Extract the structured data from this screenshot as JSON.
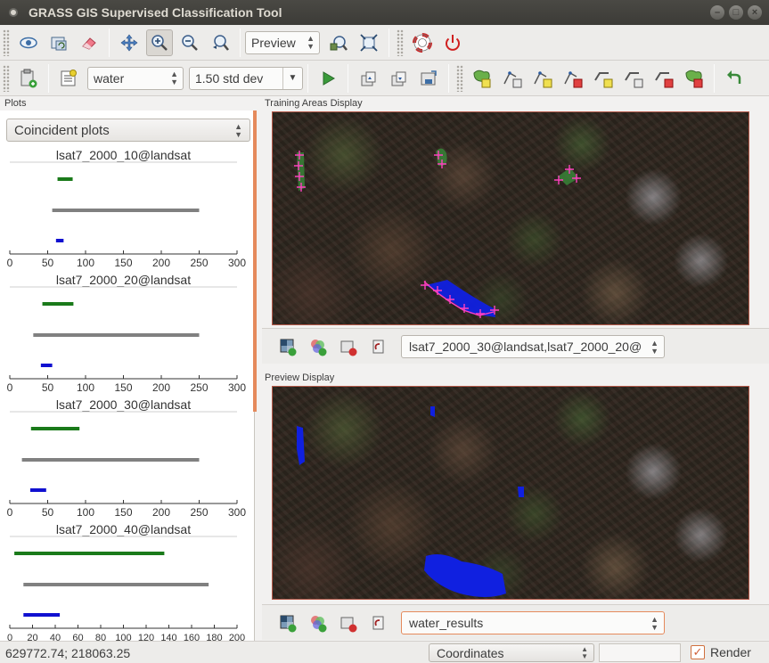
{
  "window": {
    "title": "GRASS GIS Supervised Classification Tool",
    "buttons": [
      "–",
      "□",
      "×"
    ]
  },
  "toolbar1": {
    "preview_mode": "Preview"
  },
  "toolbar2": {
    "class_name": "water",
    "std_dev": "1.50 std dev"
  },
  "plots": {
    "panel_label": "Plots",
    "view_mode": "Coincident plots",
    "bar_colors": {
      "training": "#1a7a1a",
      "map": "#808080",
      "highlight": "#1010d0"
    },
    "charts": [
      {
        "title": "lsat7_2000_10@landsat",
        "ticks": [
          "0",
          "50",
          "100",
          "150",
          "200",
          "250",
          "300"
        ],
        "tick_values": [
          0,
          50,
          100,
          150,
          200,
          250,
          300
        ],
        "xlim": [
          0,
          300
        ],
        "bars": [
          {
            "color": "training",
            "range": [
              63,
              83
            ]
          },
          {
            "color": "map",
            "range": [
              56,
              250
            ]
          },
          {
            "color": "highlight",
            "range": [
              61,
              71
            ]
          }
        ]
      },
      {
        "title": "lsat7_2000_20@landsat",
        "ticks": [
          "0",
          "50",
          "100",
          "150",
          "200",
          "250",
          "300"
        ],
        "tick_values": [
          0,
          50,
          100,
          150,
          200,
          250,
          300
        ],
        "xlim": [
          0,
          300
        ],
        "bars": [
          {
            "color": "training",
            "range": [
              43,
              84
            ]
          },
          {
            "color": "map",
            "range": [
              31,
              250
            ]
          },
          {
            "color": "highlight",
            "range": [
              41,
              56
            ]
          }
        ]
      },
      {
        "title": "lsat7_2000_30@landsat",
        "ticks": [
          "0",
          "50",
          "100",
          "150",
          "200",
          "250",
          "300"
        ],
        "tick_values": [
          0,
          50,
          100,
          150,
          200,
          250,
          300
        ],
        "xlim": [
          0,
          300
        ],
        "bars": [
          {
            "color": "training",
            "range": [
              28,
              92
            ]
          },
          {
            "color": "map",
            "range": [
              16,
              250
            ]
          },
          {
            "color": "highlight",
            "range": [
              27,
              48
            ]
          }
        ]
      },
      {
        "title": "lsat7_2000_40@landsat",
        "ticks": [
          "0",
          "20",
          "40",
          "60",
          "80",
          "100",
          "120",
          "140",
          "160",
          "180",
          "200"
        ],
        "tick_values": [
          0,
          20,
          40,
          60,
          80,
          100,
          120,
          140,
          160,
          180,
          200
        ],
        "xlim": [
          0,
          200
        ],
        "bars": [
          {
            "color": "training",
            "range": [
              4,
              136
            ]
          },
          {
            "color": "map",
            "range": [
              12,
              175
            ]
          },
          {
            "color": "highlight",
            "range": [
              12,
              44
            ]
          }
        ]
      }
    ]
  },
  "training_display": {
    "label": "Training Areas Display",
    "layer_value": "lsat7_2000_30@landsat,lsat7_2000_20@"
  },
  "preview_display": {
    "label": "Preview Display",
    "layer_value": "water_results"
  },
  "statusbar": {
    "coordinates": "629772.74; 218063.25",
    "mode": "Coordinates",
    "render_label": "Render",
    "render_checked": true
  }
}
